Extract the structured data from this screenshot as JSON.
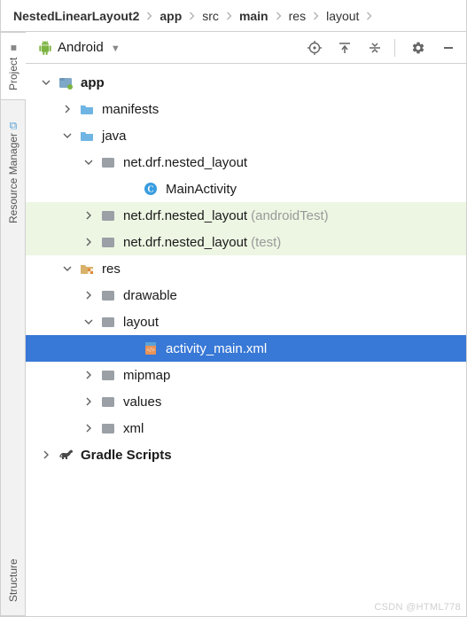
{
  "breadcrumb": {
    "items": [
      "NestedLinearLayout2",
      "app",
      "src",
      "main",
      "res",
      "layout"
    ],
    "bold_indices": [
      0,
      1,
      3
    ]
  },
  "left_rail": {
    "tabs": [
      {
        "label": "Project",
        "icon": "■"
      },
      {
        "label": "Resource Manager",
        "icon": "⧉"
      },
      {
        "label": "Structure",
        "icon": ""
      }
    ]
  },
  "panel_header": {
    "dropdown_label": "Android",
    "buttons": [
      "target",
      "collapse",
      "expand",
      "settings",
      "minimize"
    ]
  },
  "tree": [
    {
      "indent": 0,
      "arrow": "down",
      "icon": "module",
      "label": "app",
      "bold": true
    },
    {
      "indent": 1,
      "arrow": "right",
      "icon": "folder-blue",
      "label": "manifests"
    },
    {
      "indent": 1,
      "arrow": "down",
      "icon": "folder-blue",
      "label": "java"
    },
    {
      "indent": 2,
      "arrow": "down",
      "icon": "package",
      "label": "net.drf.nested_layout"
    },
    {
      "indent": 4,
      "arrow": "none",
      "icon": "class",
      "label": "MainActivity"
    },
    {
      "indent": 2,
      "arrow": "right",
      "icon": "package",
      "label": "net.drf.nested_layout",
      "suffix": "(androidTest)",
      "bg": "green"
    },
    {
      "indent": 2,
      "arrow": "right",
      "icon": "package",
      "label": "net.drf.nested_layout",
      "suffix": "(test)",
      "bg": "green"
    },
    {
      "indent": 1,
      "arrow": "down",
      "icon": "folder-res",
      "label": "res"
    },
    {
      "indent": 2,
      "arrow": "right",
      "icon": "package",
      "label": "drawable"
    },
    {
      "indent": 2,
      "arrow": "down",
      "icon": "package",
      "label": "layout"
    },
    {
      "indent": 4,
      "arrow": "none",
      "icon": "xml",
      "label": "activity_main.xml",
      "selected": true
    },
    {
      "indent": 2,
      "arrow": "right",
      "icon": "package",
      "label": "mipmap"
    },
    {
      "indent": 2,
      "arrow": "right",
      "icon": "package",
      "label": "values"
    },
    {
      "indent": 2,
      "arrow": "right",
      "icon": "package",
      "label": "xml"
    },
    {
      "indent": 0,
      "arrow": "right",
      "icon": "gradle",
      "label": "Gradle Scripts",
      "bold": true
    }
  ],
  "watermark": "CSDN @HTML778"
}
